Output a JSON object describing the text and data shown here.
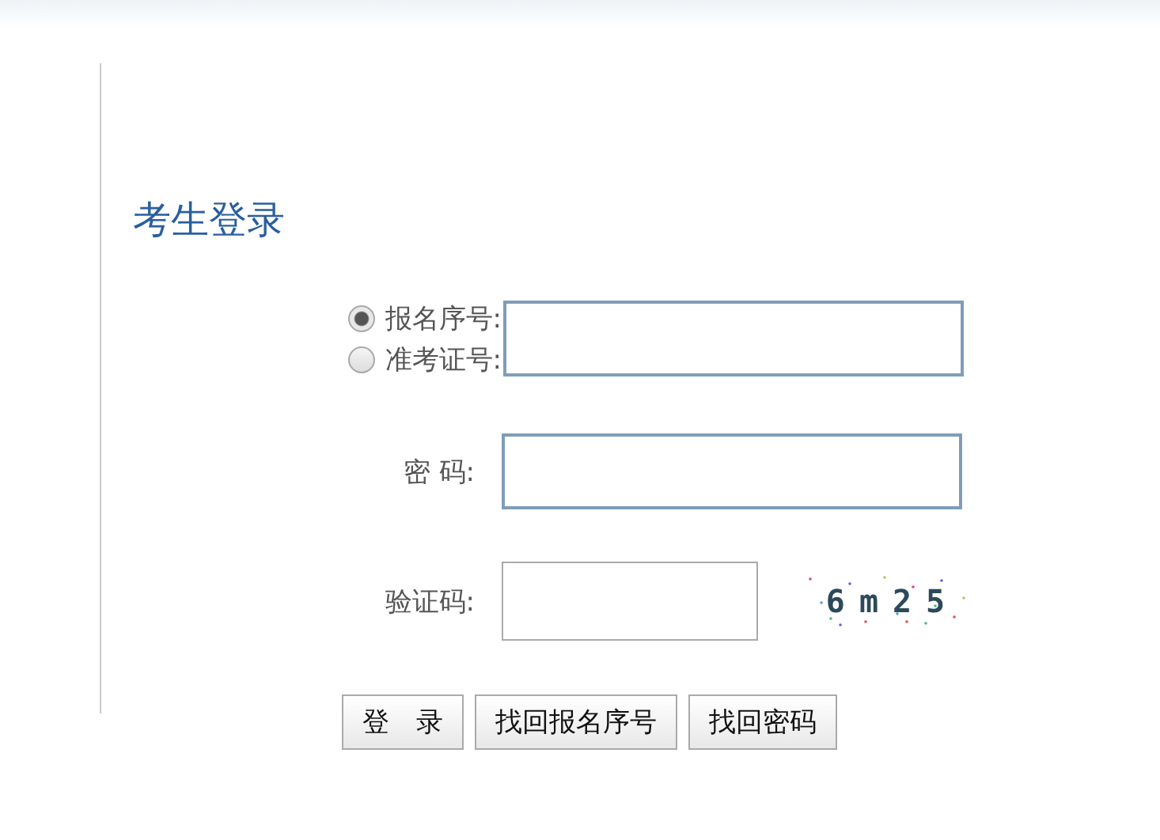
{
  "title": "考生登录",
  "id_options": [
    {
      "label": "报名序号:",
      "selected": true
    },
    {
      "label": "准考证号:",
      "selected": false
    }
  ],
  "password": {
    "label": "密 码:"
  },
  "captcha": {
    "label": "验证码:",
    "code": "6m25"
  },
  "buttons": [
    "登　录",
    "找回报名序号",
    "找回密码"
  ]
}
